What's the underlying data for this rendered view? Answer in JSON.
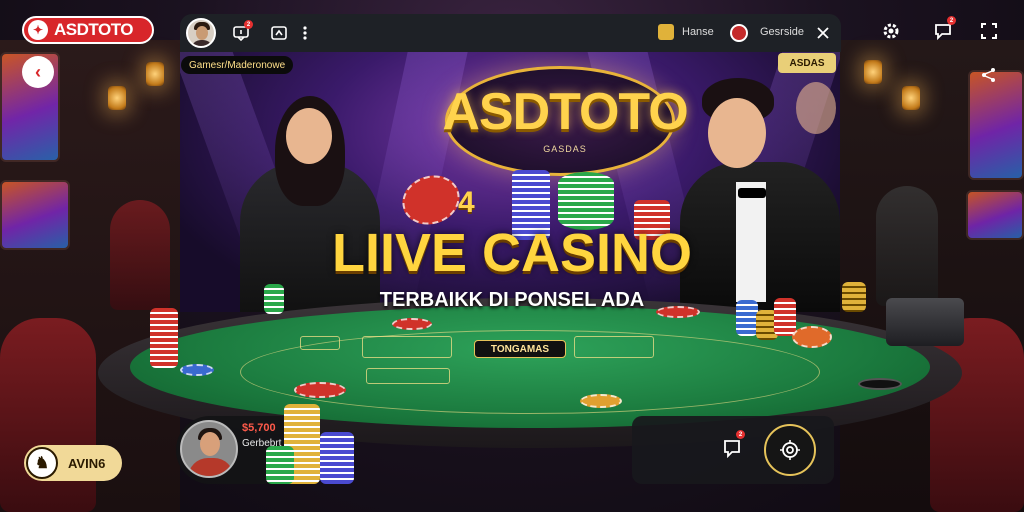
{
  "brand": {
    "name": "ASDTOTO"
  },
  "window_bar": {
    "notification_count": "2",
    "home_label": "Hanse",
    "exit_label": "Gesrside"
  },
  "right_controls": {
    "notification_count": "2"
  },
  "stage": {
    "breadcrumb": "Gamesr/Maderonowe",
    "corner_tag": "ASDAS",
    "logo": "ASDTOTO",
    "logo_sub": "GASDAS"
  },
  "hero": {
    "title": "LIIVE CASINO",
    "subtitle": "TERBAIKK DI PONSEL ADA"
  },
  "table": {
    "tournament_label": "TONGAMAS"
  },
  "player": {
    "amount": "$5,700",
    "name": "Gerbebrt"
  },
  "action_panel": {
    "notification_count": "2"
  },
  "balance": {
    "amount": "AVIN6"
  },
  "colors": {
    "brand_red": "#d8262a",
    "gold": "#ffd34d",
    "felt": "#1b7a3e",
    "bar_bg": "#1e2126"
  }
}
